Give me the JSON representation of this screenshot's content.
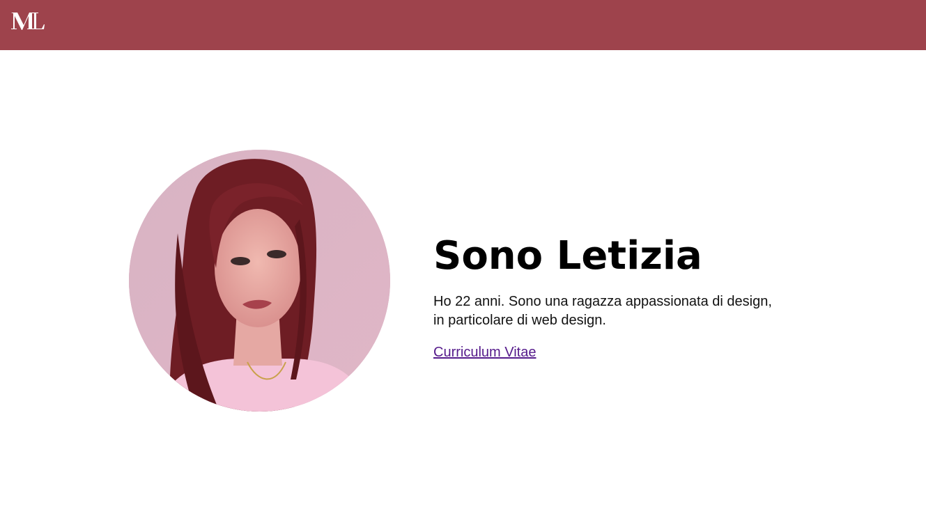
{
  "header": {
    "logo_text": "ML",
    "colors": {
      "bar": "#9e434c",
      "logo": "#ffffff"
    }
  },
  "profile": {
    "photo_icon": "portrait-photo",
    "title": "Sono Letizia",
    "description_line1": "Ho 22 anni. Sono una ragazza appassionata di design,",
    "description_line2": "in particolare di web design.",
    "cv_link_label": "Curriculum Vitae",
    "colors": {
      "link": "#551a8b",
      "text": "#000000"
    }
  }
}
